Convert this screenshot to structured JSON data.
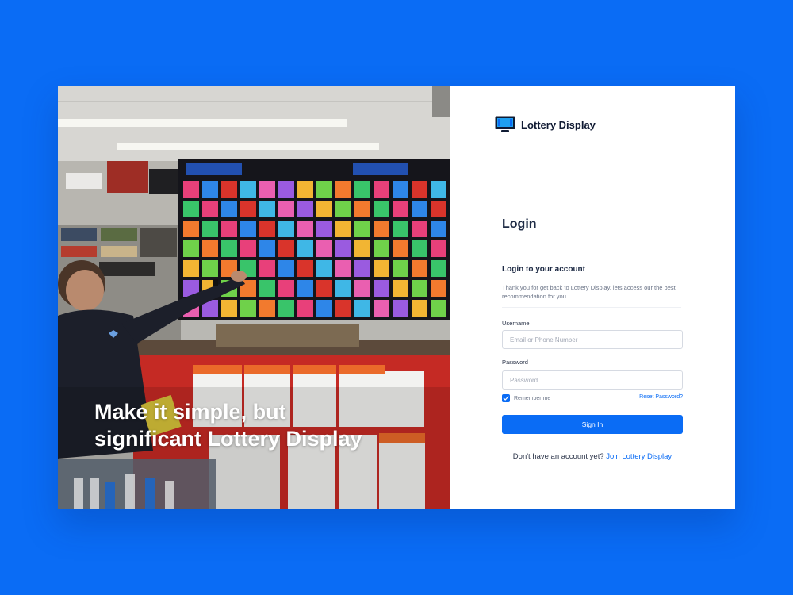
{
  "colors": {
    "background": "#0a6cf5",
    "accent": "#0a6cf5",
    "heading": "#1e2b45",
    "muted": "#6b7487"
  },
  "hero": {
    "image": "lottery-store-display-photo",
    "line1": "Make it simple, but",
    "line2": "significant Lottery Display"
  },
  "brand": {
    "icon": "monitor-icon",
    "name": "Lottery Display"
  },
  "login": {
    "title": "Login",
    "subtitle": "Login to your account",
    "intro": "Thank you for get back to Lottery Display, lets access our the best recommendation for you",
    "username": {
      "label": "Username",
      "placeholder": "Email or Phone Number",
      "value": ""
    },
    "password": {
      "label": "Password",
      "placeholder": "Password",
      "value": ""
    },
    "remember": {
      "label": "Remember me",
      "checked": true
    },
    "reset_link": "Reset Password?",
    "submit_label": "Sign In",
    "signup_prompt": "Don't have an account yet?",
    "signup_link": "Join Lottery Display"
  }
}
